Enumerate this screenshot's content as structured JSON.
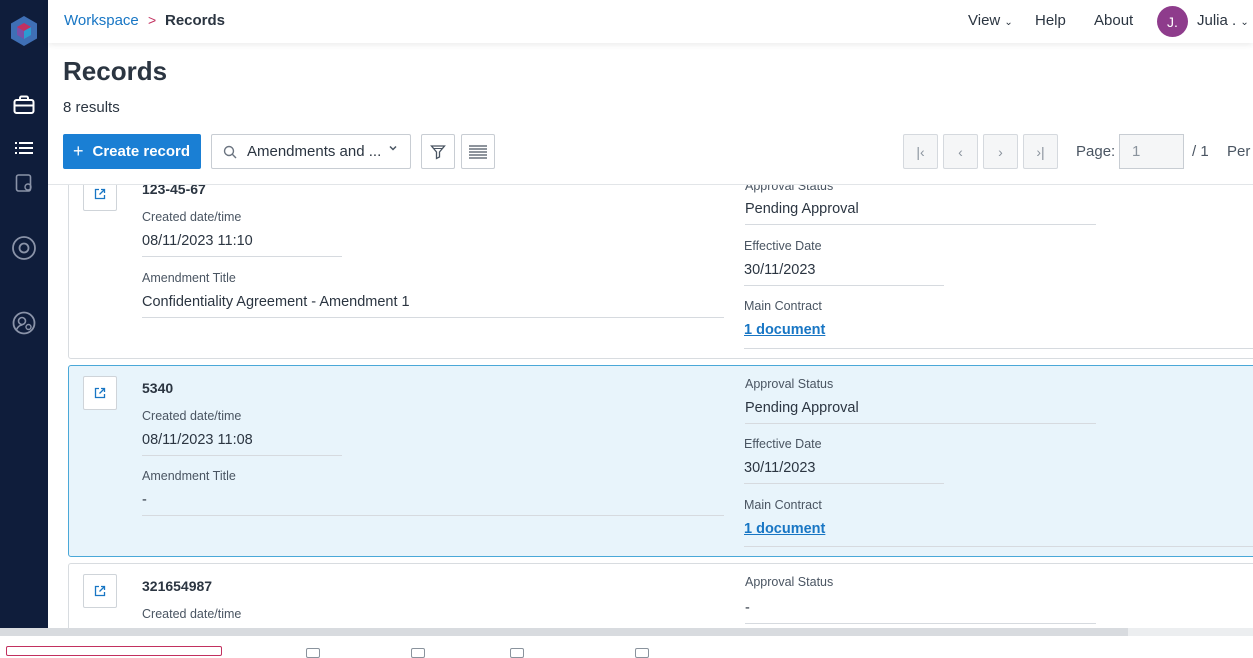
{
  "breadcrumb": {
    "workspace": "Workspace",
    "separator": ">",
    "current": "Records"
  },
  "topnav": {
    "view": "View",
    "help": "Help",
    "about": "About",
    "user_initial": "J.",
    "user_name": "Julia .",
    "avatar_color": "#8e3c8c"
  },
  "sidebar": {
    "icons": [
      "app-logo-icon",
      "briefcase-icon",
      "list-icon",
      "document-icon",
      "gear-icon",
      "user-settings-icon"
    ]
  },
  "page": {
    "title": "Records",
    "results": "8 results"
  },
  "toolbar": {
    "create_label": "Create record",
    "view_select": "Amendments and ...",
    "accent": "#1a7fd4"
  },
  "pagination": {
    "page_label": "Page:",
    "page_value": "1",
    "total": "/ 1",
    "per_label": "Per"
  },
  "labels": {
    "created": "Created date/time",
    "amendment_title": "Amendment Title",
    "approval_status": "Approval Status",
    "effective_date": "Effective Date",
    "main_contract": "Main Contract"
  },
  "records": [
    {
      "id": "123-45-67",
      "created": "08/11/2023 11:10",
      "title": "Confidentiality Agreement - Amendment 1",
      "status": "Pending Approval",
      "effective": "30/11/2023",
      "contract": "1 document"
    },
    {
      "id": "5340",
      "created": "08/11/2023 11:08",
      "title": "-",
      "status": "Pending Approval",
      "effective": "30/11/2023",
      "contract": "1 document"
    },
    {
      "id": "321654987",
      "status": "-"
    }
  ]
}
